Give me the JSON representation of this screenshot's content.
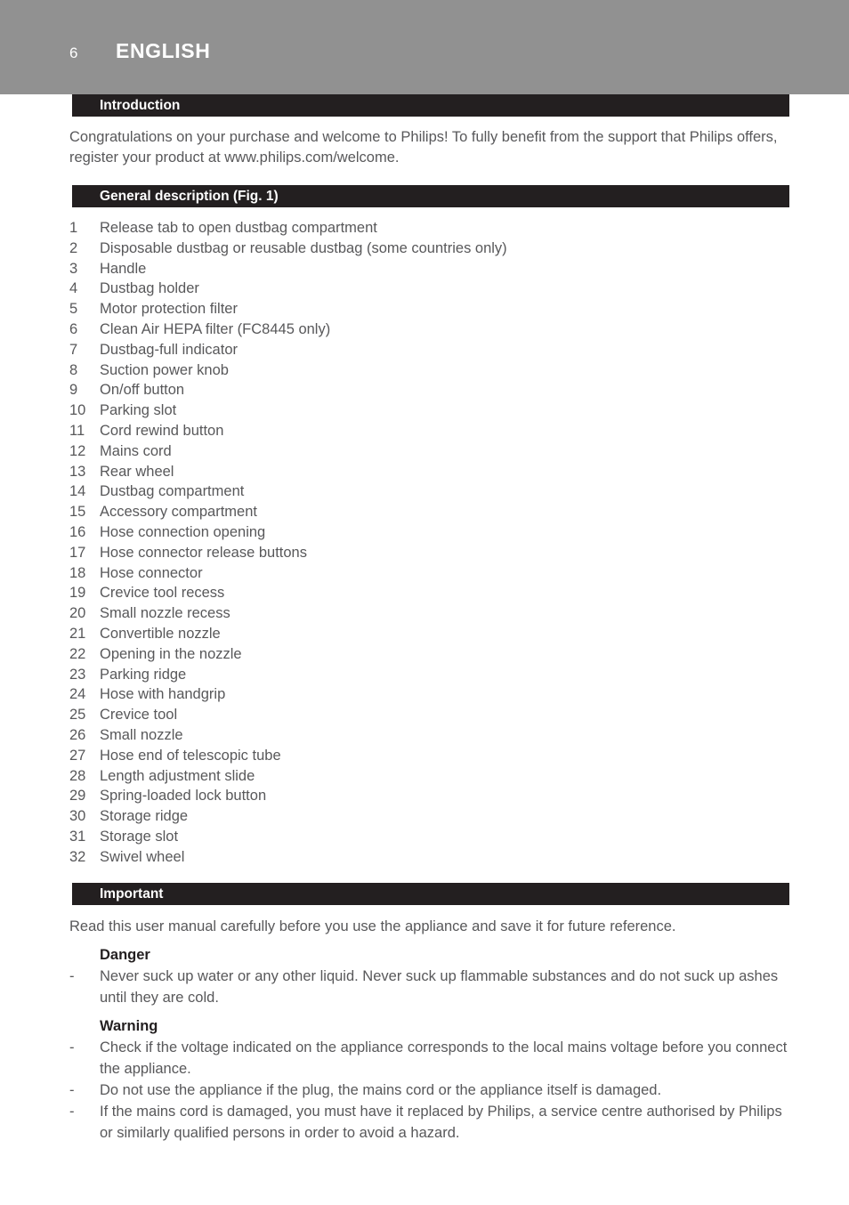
{
  "page": {
    "number": "6",
    "language": "ENGLISH"
  },
  "colors": {
    "header_band": "#919191",
    "section_bar": "#231f20",
    "body_text": "#58585a",
    "heading_text": "#231f20",
    "page_background": "#ffffff"
  },
  "sections": {
    "introduction": {
      "heading": "Introduction",
      "paragraph": "Congratulations on your purchase and welcome to Philips! To fully benefit from the support that Philips offers, register your product at www.philips.com/welcome."
    },
    "general_description": {
      "heading": "General description (Fig. 1)",
      "items": [
        {
          "num": "1",
          "text": "Release tab to open dustbag compartment"
        },
        {
          "num": "2",
          "text": "Disposable dustbag or reusable dustbag (some countries only)"
        },
        {
          "num": "3",
          "text": "Handle"
        },
        {
          "num": "4",
          "text": "Dustbag holder"
        },
        {
          "num": "5",
          "text": "Motor protection filter"
        },
        {
          "num": "6",
          "text": "Clean Air HEPA filter (FC8445 only)"
        },
        {
          "num": "7",
          "text": "Dustbag-full indicator"
        },
        {
          "num": "8",
          "text": "Suction power knob"
        },
        {
          "num": "9",
          "text": "On/off button"
        },
        {
          "num": "10",
          "text": "Parking slot"
        },
        {
          "num": "11",
          "text": "Cord rewind button"
        },
        {
          "num": "12",
          "text": "Mains cord"
        },
        {
          "num": "13",
          "text": "Rear wheel"
        },
        {
          "num": "14",
          "text": "Dustbag compartment"
        },
        {
          "num": "15",
          "text": "Accessory compartment"
        },
        {
          "num": "16",
          "text": "Hose connection opening"
        },
        {
          "num": "17",
          "text": "Hose connector release buttons"
        },
        {
          "num": "18",
          "text": "Hose connector"
        },
        {
          "num": "19",
          "text": "Crevice tool recess"
        },
        {
          "num": "20",
          "text": "Small nozzle recess"
        },
        {
          "num": "21",
          "text": "Convertible nozzle"
        },
        {
          "num": "22",
          "text": "Opening in the nozzle"
        },
        {
          "num": "23",
          "text": "Parking ridge"
        },
        {
          "num": "24",
          "text": "Hose with handgrip"
        },
        {
          "num": "25",
          "text": "Crevice tool"
        },
        {
          "num": "26",
          "text": "Small nozzle"
        },
        {
          "num": "27",
          "text": "Hose end of telescopic tube"
        },
        {
          "num": "28",
          "text": "Length adjustment slide"
        },
        {
          "num": "29",
          "text": "Spring-loaded lock button"
        },
        {
          "num": "30",
          "text": "Storage ridge"
        },
        {
          "num": "31",
          "text": "Storage slot"
        },
        {
          "num": "32",
          "text": "Swivel wheel"
        }
      ]
    },
    "important": {
      "heading": "Important",
      "paragraph": "Read this user manual carefully before you use the appliance and save it for future reference.",
      "danger": {
        "heading": "Danger",
        "bullet_marker": "-",
        "items": [
          "Never suck up water or any other liquid. Never suck up flammable substances and do not suck up ashes until they are cold."
        ]
      },
      "warning": {
        "heading": "Warning",
        "bullet_marker": "-",
        "items": [
          "Check if the voltage indicated on the appliance corresponds to the local mains voltage before you connect the appliance.",
          "Do not use the appliance if the plug, the mains cord or the appliance itself is damaged.",
          "If the mains cord is damaged, you must have it replaced by Philips, a service centre authorised by Philips or similarly qualified persons in order to avoid a hazard."
        ]
      }
    }
  }
}
